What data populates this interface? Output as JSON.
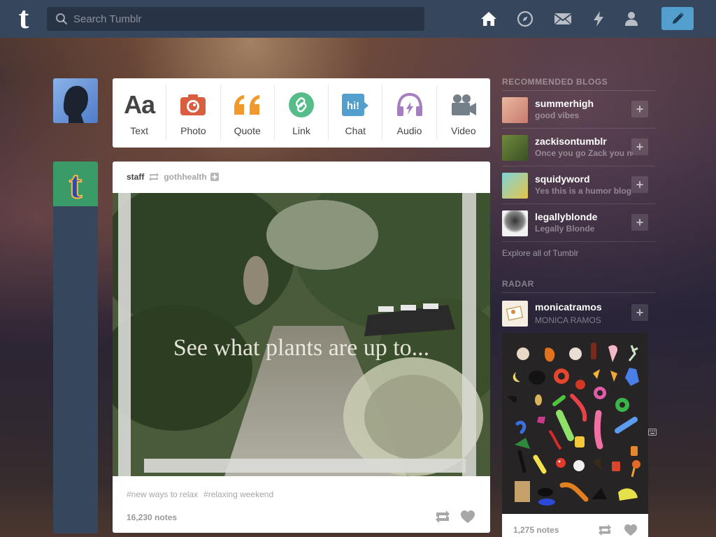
{
  "header": {
    "search_placeholder": "Search Tumblr",
    "icons": [
      "home-icon",
      "explore-icon",
      "inbox-icon",
      "activity-icon",
      "account-icon",
      "compose-icon"
    ]
  },
  "post_types": [
    {
      "label": "Text",
      "icon": "text-icon",
      "color": "#444444"
    },
    {
      "label": "Photo",
      "icon": "camera-icon",
      "color": "#d95e40"
    },
    {
      "label": "Quote",
      "icon": "quote-icon",
      "color": "#f2992e"
    },
    {
      "label": "Link",
      "icon": "link-icon",
      "color": "#56bc8a"
    },
    {
      "label": "Chat",
      "icon": "chat-icon",
      "color": "#529ecc"
    },
    {
      "label": "Audio",
      "icon": "headphones-icon",
      "color": "#a77dc2"
    },
    {
      "label": "Video",
      "icon": "video-icon",
      "color": "#748089"
    }
  ],
  "post": {
    "author": "staff",
    "reblogged_from": "gothhealth",
    "image_caption": "See what plants are up to...",
    "tags": [
      "#new ways to relax",
      "#relaxing weekend"
    ],
    "notes": "16,230 notes"
  },
  "sidebar": {
    "recommended_title": "RECOMMENDED BLOGS",
    "blogs": [
      {
        "name": "summerhigh",
        "desc": "good vibes"
      },
      {
        "name": "zackisontumblr",
        "desc": "Once you go Zack you never go back"
      },
      {
        "name": "squidyword",
        "desc": "Yes this is a humor blog"
      },
      {
        "name": "legallyblonde",
        "desc": "Legally Blonde"
      }
    ],
    "explore_link": "Explore all of Tumblr",
    "radar_title": "RADAR",
    "radar": {
      "name": "monicatramos",
      "desc": "MONICA RAMOS",
      "notes": "1,275 notes"
    }
  },
  "colors": {
    "header_bg": "#36465d",
    "compose_bg": "#529ecc"
  }
}
